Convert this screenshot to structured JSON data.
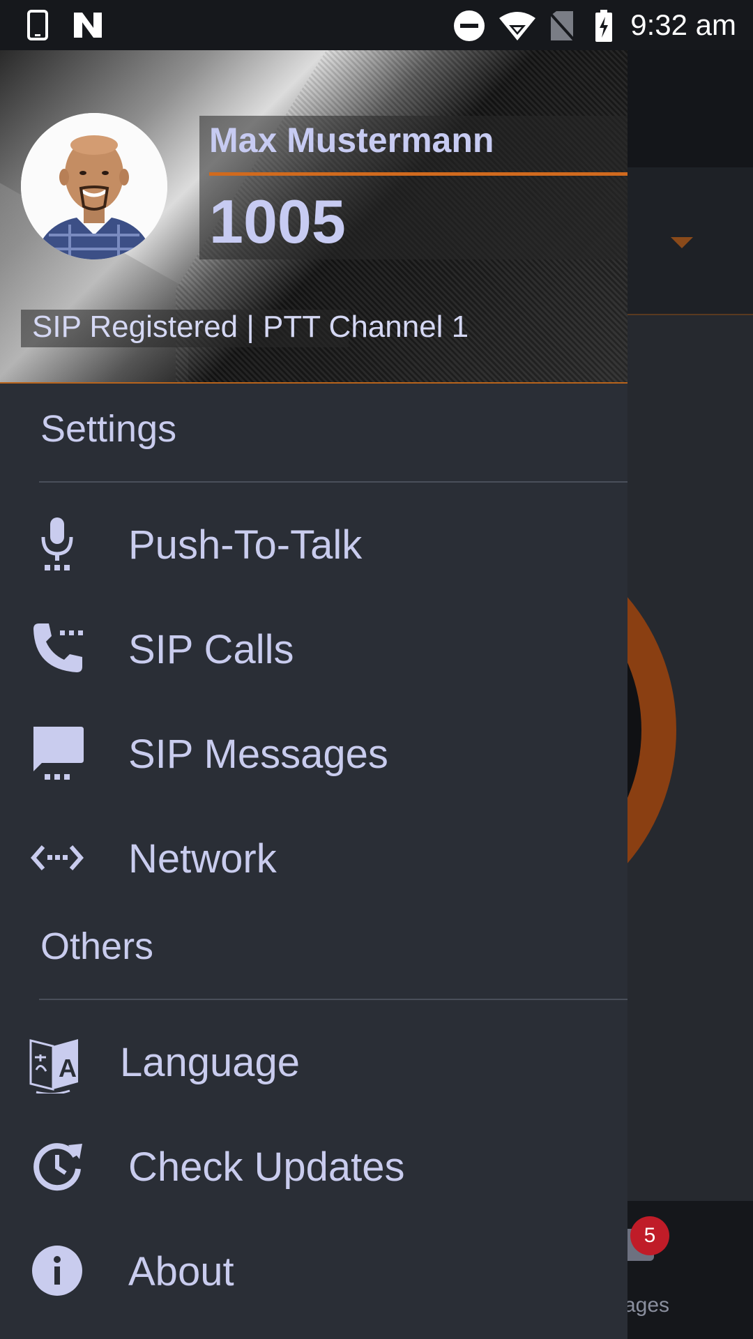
{
  "status_bar": {
    "time": "9:32 am",
    "icons": [
      "phone-icon",
      "app-n-icon",
      "do-not-disturb-icon",
      "wifi-icon",
      "no-sim-icon",
      "battery-charging-icon"
    ]
  },
  "drawer": {
    "user_name": "Max Mustermann",
    "extension": "1005",
    "status": "SIP Registered | PTT Channel 1",
    "sections": [
      {
        "title": "Settings",
        "items": [
          {
            "label": "Push-To-Talk",
            "icon": "microphone-icon"
          },
          {
            "label": "SIP Calls",
            "icon": "phone-settings-icon"
          },
          {
            "label": "SIP Messages",
            "icon": "message-settings-icon"
          },
          {
            "label": "Network",
            "icon": "network-icon"
          }
        ]
      },
      {
        "title": "Others",
        "items": [
          {
            "label": "Language",
            "icon": "translate-icon"
          },
          {
            "label": "Check Updates",
            "icon": "update-icon"
          },
          {
            "label": "About",
            "icon": "info-icon"
          }
        ]
      }
    ]
  },
  "background_app": {
    "badge_count": "5",
    "tab_label_partial": "sages"
  },
  "colors": {
    "drawer_bg": "#2a2e36",
    "text": "#c9ccee",
    "accent": "#d06a1e",
    "badge": "#c01c28"
  }
}
